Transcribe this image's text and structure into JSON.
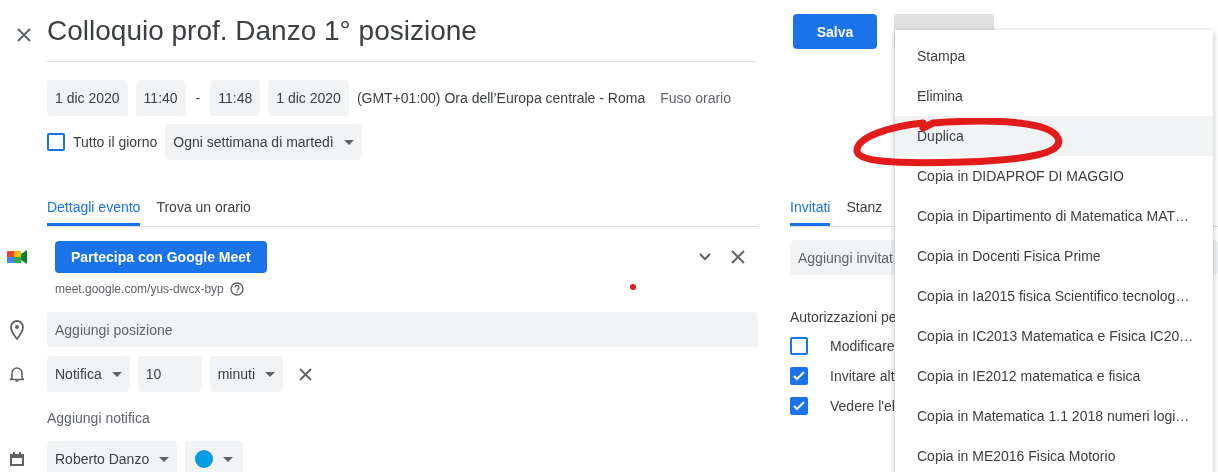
{
  "title": "Colloquio prof. Danzo 1° posizione",
  "date_time": {
    "start_date": "1 dic 2020",
    "start_time": "11:40",
    "separator": "-",
    "end_time": "11:48",
    "end_date": "1 dic 2020",
    "timezone": "(GMT+01:00) Ora dell’Europa centrale - Roma",
    "timezone_link": "Fuso orario"
  },
  "all_day": {
    "label": "Tutto il giorno",
    "checked": false
  },
  "recurrence": "Ogni settimana di martedì",
  "tabs": [
    {
      "label": "Dettagli evento",
      "selected": true
    },
    {
      "label": "Trova un orario",
      "selected": false
    }
  ],
  "meet": {
    "button": "Partecipa con Google Meet",
    "link": "meet.google.com/yus-dwcx-byp"
  },
  "location": {
    "placeholder": "Aggiungi posizione"
  },
  "notification": {
    "type": "Notifica",
    "amount": "10",
    "unit": "minuti"
  },
  "add_notification": "Aggiungi notifica",
  "calendar": {
    "owner": "Roberto Danzo",
    "color": "#039be5"
  },
  "save_button": "Salva",
  "guest_tabs": [
    {
      "label": "Invitati",
      "selected": true
    },
    {
      "label": "Stanz",
      "selected": false
    }
  ],
  "guests": {
    "placeholder": "Aggiungi invitat"
  },
  "permissions": {
    "heading": "Autorizzazioni pe",
    "items": [
      {
        "label": "Modificare",
        "checked": false
      },
      {
        "label": "Invitare alt",
        "checked": true
      },
      {
        "label": "Vedere l'el",
        "checked": true
      }
    ]
  },
  "menu": {
    "items": [
      {
        "label": "Stampa",
        "selected": false
      },
      {
        "label": "Elimina",
        "selected": false
      },
      {
        "label": "Duplica",
        "selected": true
      },
      {
        "label": "Copia in DIDAPROF DI MAGGIO",
        "selected": false
      },
      {
        "label": "Copia in Dipartimento di Matematica MAT…",
        "selected": false
      },
      {
        "label": "Copia in Docenti Fisica Prime",
        "selected": false
      },
      {
        "label": "Copia in Ia2015 fisica Scientifico tecnolog…",
        "selected": false
      },
      {
        "label": "Copia in IC2013 Matematica e Fisica IC20…",
        "selected": false
      },
      {
        "label": "Copia in IE2012 matematica e fisica",
        "selected": false
      },
      {
        "label": "Copia in Matematica 1.1 2018 numeri logi…",
        "selected": false
      },
      {
        "label": "Copia in ME2016 Fisica Motorio",
        "selected": false
      }
    ]
  }
}
